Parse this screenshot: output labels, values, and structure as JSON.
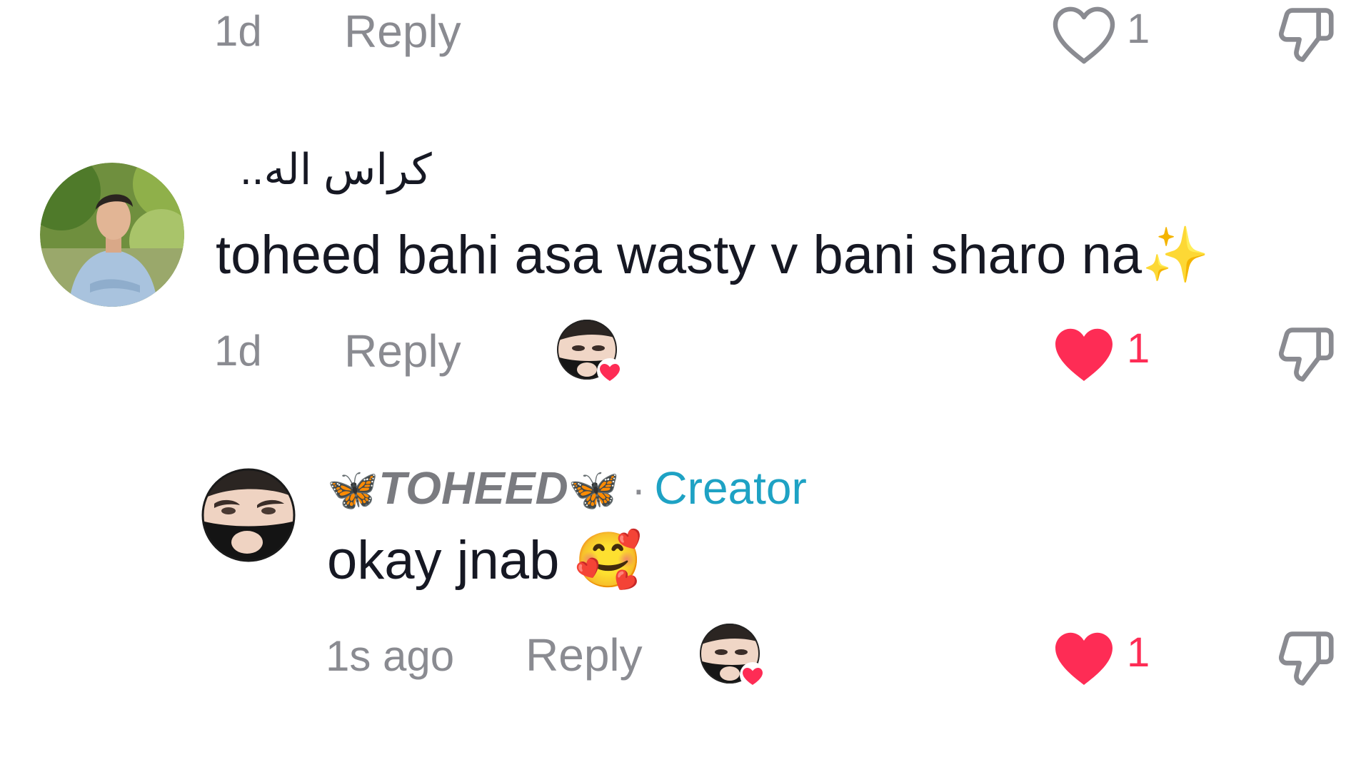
{
  "comment_top": {
    "time": "1d",
    "reply_label": "Reply",
    "like_count": "1",
    "liked": false
  },
  "comment_main": {
    "username": "كراس اله..",
    "text": "toheed bahi asa wasty v bani sharo na",
    "emoji": "✨",
    "time": "1d",
    "reply_label": "Reply",
    "like_count": "1",
    "liked": true
  },
  "reply": {
    "username": "TOHEED",
    "username_decor_left": "🦋",
    "username_decor_right": "🦋",
    "separator": "·",
    "creator_label": "Creator",
    "text": "okay jnab",
    "emoji": "🥰",
    "time": "1s ago",
    "reply_label": "Reply",
    "like_count": "1",
    "liked": true
  },
  "colors": {
    "like_red": "#fe2c55",
    "meta_grey": "#8a8b91",
    "creator_blue": "#1ea2c4",
    "text_dark": "#161823"
  },
  "icons": {
    "like": "heart-outline-icon",
    "liked": "heart-filled-icon",
    "dislike": "thumbs-down-icon",
    "creator_liked": "creator-liked-badge"
  }
}
